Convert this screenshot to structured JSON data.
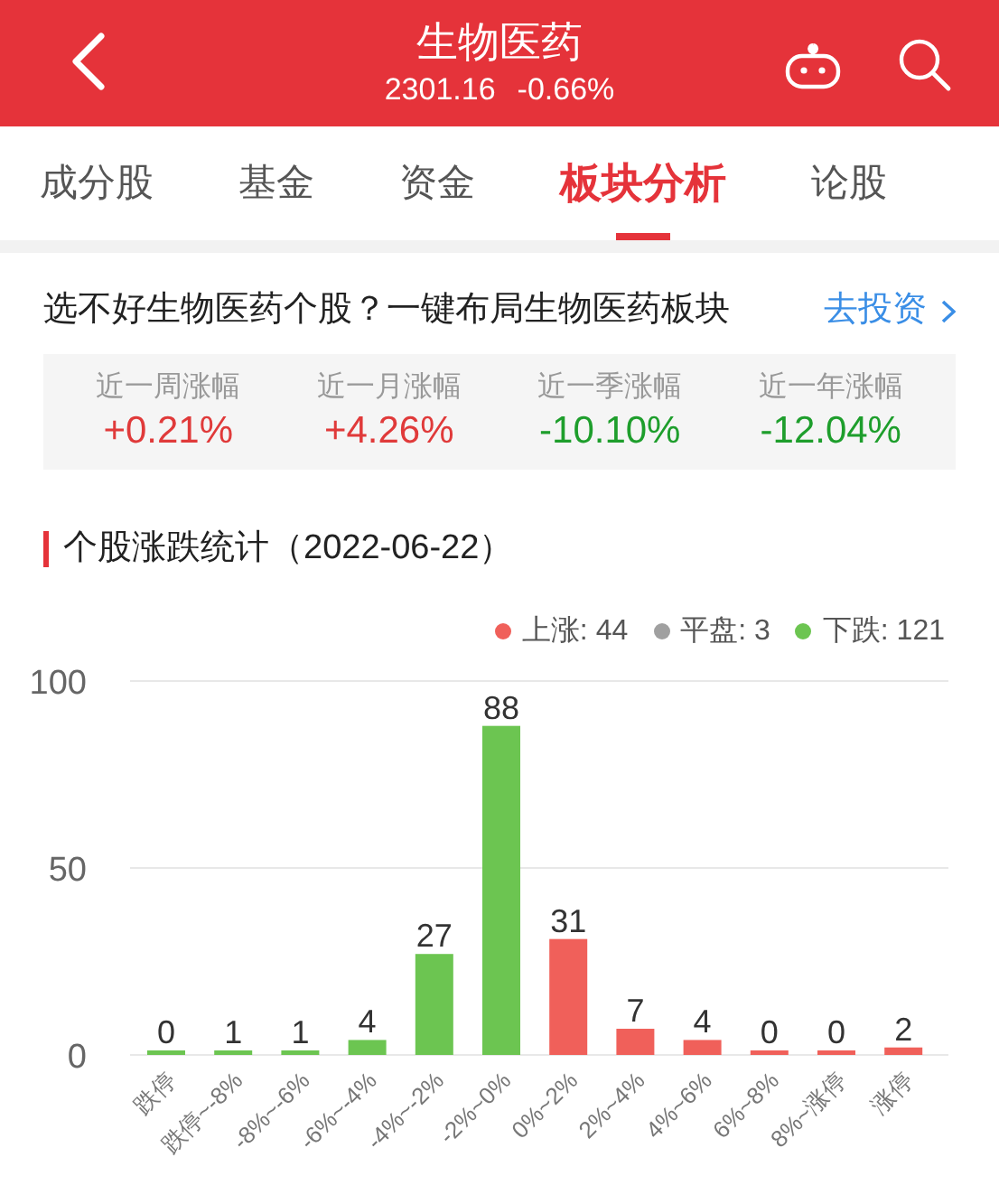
{
  "header": {
    "title": "生物医药",
    "price": "2301.16",
    "change": "-0.66%"
  },
  "tabs": [
    {
      "label": "成分股",
      "selected": false
    },
    {
      "label": "基金",
      "selected": false
    },
    {
      "label": "资金",
      "selected": false
    },
    {
      "label": "板块分析",
      "selected": true
    },
    {
      "label": "论股",
      "selected": false
    }
  ],
  "promo": {
    "text": "选不好生物医药个股？一键布局生物医药板块",
    "link": "去投资"
  },
  "returns": [
    {
      "label": "近一周涨幅",
      "value": "+0.21%",
      "color": "#e03a3a"
    },
    {
      "label": "近一月涨幅",
      "value": "+4.26%",
      "color": "#e03a3a"
    },
    {
      "label": "近一季涨幅",
      "value": "-10.10%",
      "color": "#1e9e2c"
    },
    {
      "label": "近一年涨幅",
      "value": "-12.04%",
      "color": "#1e9e2c"
    }
  ],
  "section_title": "个股涨跌统计（2022-06-22）",
  "legend": [
    {
      "kind": "series",
      "suffix": ": 44"
    },
    {
      "kind": "flat",
      "label": "平盘",
      "suffix": ": 3",
      "color": "#a0a0a0"
    },
    {
      "kind": "series",
      "suffix": ": 121"
    }
  ],
  "chart_data": {
    "type": "bar",
    "categories": [
      "跌停",
      "跌停~-8%",
      "-8%~-6%",
      "-6%~-4%",
      "-4%~-2%",
      "-2%~0%",
      "0%~2%",
      "2%~4%",
      "4%~6%",
      "6%~8%",
      "8%~涨停",
      "涨停"
    ],
    "series": [
      {
        "name": "上涨",
        "color": "#f0605a",
        "values": [
          null,
          null,
          null,
          null,
          null,
          null,
          31,
          7,
          4,
          0,
          0,
          2
        ]
      },
      {
        "name": "下跌",
        "color": "#6cc551",
        "values": [
          0,
          1,
          1,
          4,
          27,
          88,
          null,
          null,
          null,
          null,
          null,
          null
        ]
      }
    ],
    "ylim": [
      0,
      100
    ],
    "yticks": [
      0,
      50,
      100
    ],
    "stacked": true,
    "data_labels": true
  }
}
